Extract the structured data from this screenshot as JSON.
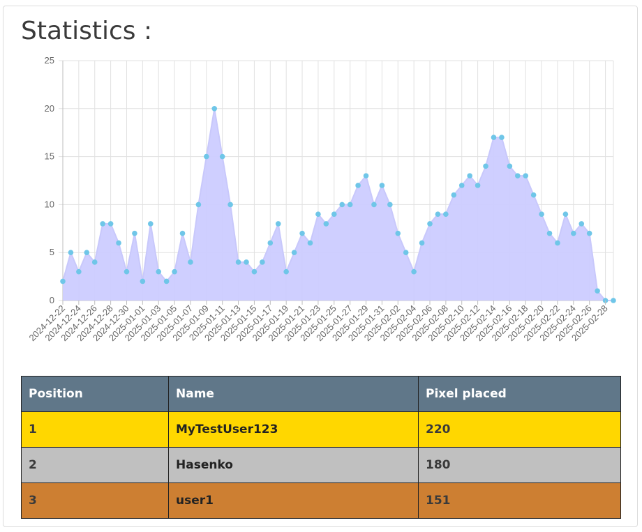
{
  "page": {
    "title": "Statistics :"
  },
  "chart_data": {
    "type": "area",
    "x": [
      "2024-12-22",
      "2024-12-23",
      "2024-12-24",
      "2024-12-25",
      "2024-12-26",
      "2024-12-27",
      "2024-12-28",
      "2024-12-29",
      "2024-12-30",
      "2024-12-31",
      "2025-01-01",
      "2025-01-02",
      "2025-01-03",
      "2025-01-04",
      "2025-01-05",
      "2025-01-06",
      "2025-01-07",
      "2025-01-08",
      "2025-01-09",
      "2025-01-10",
      "2025-01-11",
      "2025-01-12",
      "2025-01-13",
      "2025-01-14",
      "2025-01-15",
      "2025-01-16",
      "2025-01-17",
      "2025-01-18",
      "2025-01-19",
      "2025-01-20",
      "2025-01-21",
      "2025-01-22",
      "2025-01-23",
      "2025-01-24",
      "2025-01-25",
      "2025-01-26",
      "2025-01-27",
      "2025-01-28",
      "2025-01-29",
      "2025-01-30",
      "2025-01-31",
      "2025-02-01",
      "2025-02-02",
      "2025-02-03",
      "2025-02-04",
      "2025-02-05",
      "2025-02-06",
      "2025-02-07",
      "2025-02-08",
      "2025-02-09",
      "2025-02-10",
      "2025-02-11",
      "2025-02-12",
      "2025-02-13",
      "2025-02-14",
      "2025-02-15",
      "2025-02-16",
      "2025-02-17",
      "2025-02-18",
      "2025-02-19",
      "2025-02-20",
      "2025-02-21",
      "2025-02-22",
      "2025-02-23",
      "2025-02-24",
      "2025-02-25",
      "2025-02-26",
      "2025-02-27",
      "2025-02-28",
      "2025-03-01"
    ],
    "x_tick_labels": [
      "2024-12-22",
      "2024-12-24",
      "2024-12-26",
      "2024-12-28",
      "2024-12-30",
      "2025-01-01",
      "2025-01-03",
      "2025-01-05",
      "2025-01-07",
      "2025-01-09",
      "2025-01-11",
      "2025-01-13",
      "2025-01-15",
      "2025-01-17",
      "2025-01-19",
      "2025-01-21",
      "2025-01-23",
      "2025-01-25",
      "2025-01-27",
      "2025-01-29",
      "2025-01-31",
      "2025-02-02",
      "2025-02-04",
      "2025-02-06",
      "2025-02-08",
      "2025-02-10",
      "2025-02-12",
      "2025-02-14",
      "2025-02-16",
      "2025-02-18",
      "2025-02-20",
      "2025-02-22",
      "2025-02-24",
      "2025-02-26",
      "2025-02-28"
    ],
    "values": [
      2,
      5,
      3,
      5,
      4,
      8,
      8,
      6,
      3,
      7,
      2,
      8,
      3,
      2,
      3,
      7,
      4,
      10,
      15,
      20,
      15,
      10,
      4,
      4,
      3,
      4,
      6,
      8,
      3,
      5,
      7,
      6,
      9,
      8,
      9,
      10,
      10,
      12,
      13,
      10,
      12,
      10,
      7,
      5,
      3,
      6,
      8,
      9,
      9,
      11,
      12,
      13,
      12,
      14,
      17,
      17,
      14,
      13,
      13,
      11,
      9,
      7,
      6,
      9,
      7,
      8,
      7,
      1,
      0,
      0
    ],
    "ylim": [
      0,
      25
    ],
    "y_ticks": [
      "0",
      "5",
      "10",
      "15",
      "20",
      "25"
    ],
    "grid": true,
    "colors": {
      "fill": "#ccccff",
      "line": "#c8c8fb",
      "point": "#6fc6e8",
      "grid": "#e1e1e1"
    }
  },
  "table": {
    "headers": [
      "Position",
      "Name",
      "Pixel placed"
    ],
    "rows": [
      {
        "position": "1",
        "name": "MyTestUser123",
        "pixels": "220",
        "color": "#ffd700"
      },
      {
        "position": "2",
        "name": "Hasenko",
        "pixels": "180",
        "color": "#c0c0c0"
      },
      {
        "position": "3",
        "name": "user1",
        "pixels": "151",
        "color": "#cd7f32"
      }
    ],
    "header_color": "#607789"
  }
}
